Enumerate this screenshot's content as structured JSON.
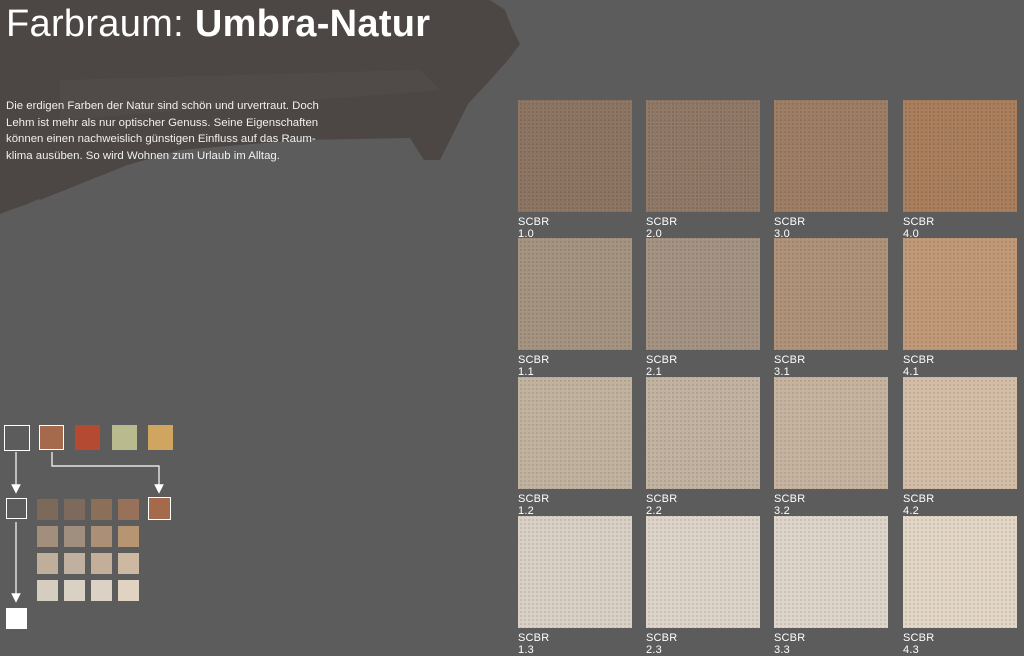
{
  "header": {
    "title_prefix": "Farbraum: ",
    "title_bold": "Umbra-Natur"
  },
  "intro": {
    "text": "Die erdigen Farben der Natur sind schön und urvertraut. Doch Lehm ist mehr als nur optischer Genuss. Seine Eigenschaften können einen nachweislich günstigen Einfluss auf das Raum-klima ausüben. So wird Wohnen zum Urlaub im Alltag."
  },
  "colors": {
    "background": "#5c5c5c",
    "brush": "#4c4644"
  },
  "swatches": [
    {
      "label": "SCBR 1.0",
      "color": "#8a715e"
    },
    {
      "label": "SCBR 2.0",
      "color": "#8d7462"
    },
    {
      "label": "SCBR 3.0",
      "color": "#9a7a60"
    },
    {
      "label": "SCBR 4.0",
      "color": "#a67a58"
    },
    {
      "label": "SCBR 1.1",
      "color": "#a1907c"
    },
    {
      "label": "SCBR 2.1",
      "color": "#a18f7e"
    },
    {
      "label": "SCBR 3.1",
      "color": "#ad8f75"
    },
    {
      "label": "SCBR 4.1",
      "color": "#be9673"
    },
    {
      "label": "SCBR 1.2",
      "color": "#bfb09c"
    },
    {
      "label": "SCBR 2.2",
      "color": "#c0b09e"
    },
    {
      "label": "SCBR 3.2",
      "color": "#c4b19c"
    },
    {
      "label": "SCBR 4.2",
      "color": "#d2bba4"
    },
    {
      "label": "SCBR 1.3",
      "color": "#d8cfc3"
    },
    {
      "label": "SCBR 2.3",
      "color": "#dcd3c7"
    },
    {
      "label": "SCBR 3.3",
      "color": "#ddd4c8"
    },
    {
      "label": "SCBR 4.3",
      "color": "#e2d5c4"
    }
  ],
  "legend": {
    "base_colors": [
      "#a5694b",
      "#b54a32",
      "#b9ba8e",
      "#cfa560"
    ],
    "mini_grid": [
      "#7d6958",
      "#7e6a5c",
      "#8b6f59",
      "#98715a",
      "#a28f7b",
      "#a08f7f",
      "#ab8f76",
      "#b79472",
      "#bfae9a",
      "#bfb09f",
      "#c3ae99",
      "#cdb8a1",
      "#d6cdc1",
      "#dad1c5",
      "#dbd1c4",
      "#e0d3c2"
    ],
    "selected_color": "#a5694b",
    "white": "#ffffff"
  }
}
